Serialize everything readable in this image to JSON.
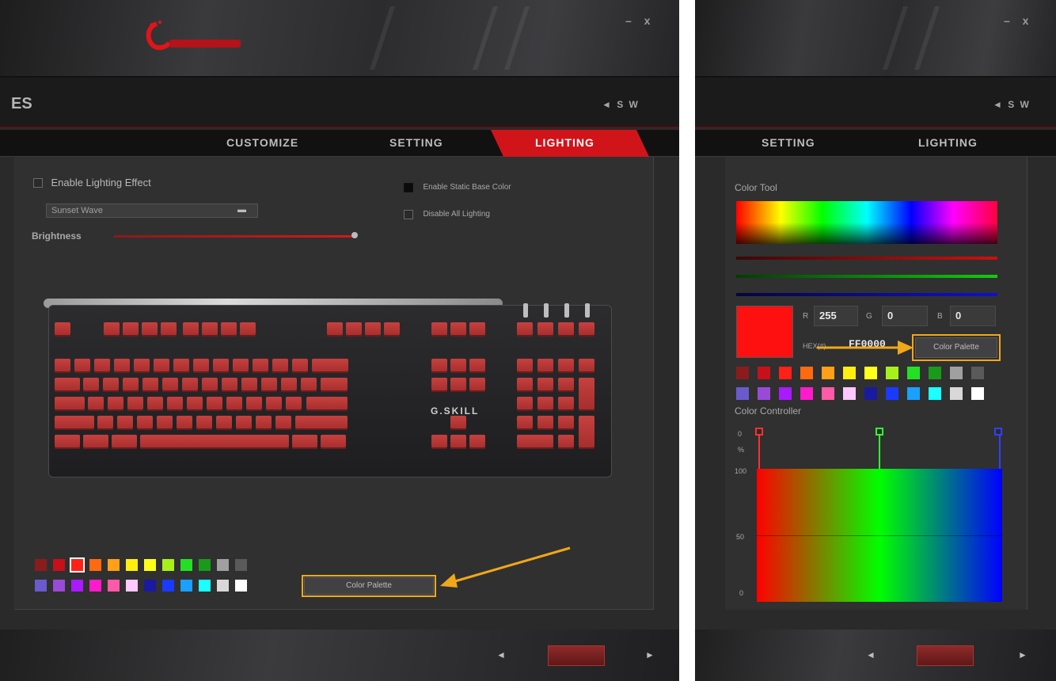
{
  "left": {
    "window_controls": "– x",
    "page_title": "ES",
    "profile_nav": "◄ S W",
    "tabs": [
      {
        "label": "CUSTOMIZE",
        "active": false
      },
      {
        "label": "SETTING",
        "active": false
      },
      {
        "label": "LIGHTING",
        "active": true
      }
    ],
    "enable_lighting_label": "Enable Lighting Effect",
    "effect_selected": "Sunset Wave",
    "brightness_label": "Brightness",
    "enable_static_label": "Enable Static Base Color",
    "disable_all_label": "Disable All Lighting",
    "keyboard_logo": "G.SKILL",
    "swatches_row1": [
      "#8a1c1c",
      "#c8101a",
      "#ff2018",
      "#ff6a10",
      "#ffa018",
      "#ffee10",
      "#ffff1a",
      "#a8f01a",
      "#24e024",
      "#1a9a1a",
      "#a0a0a0",
      "#5a5a5a"
    ],
    "swatches_row2": [
      "#6a5acd",
      "#9a4ad8",
      "#aa1aff",
      "#ff1acc",
      "#ff5aa8",
      "#ffc8ff",
      "#1a1aa0",
      "#1a3aff",
      "#1aa0ff",
      "#1affff",
      "#d8d8d8",
      "#ffffff"
    ],
    "selected_swatch_index": 2,
    "color_palette_button": "Color Palette"
  },
  "right": {
    "window_controls": "– x",
    "profile_nav": "◄ S W",
    "tabs": [
      {
        "label": "SETTING"
      },
      {
        "label": "LIGHTING"
      }
    ],
    "color_tool_label": "Color Tool",
    "r_label": "R",
    "g_label": "G",
    "b_label": "B",
    "r_value": "255",
    "g_value": "0",
    "b_value": "0",
    "hex_label": "HEX(#)",
    "hex_value": "FF0000",
    "preview_color": "#ff1010",
    "color_palette_button": "Color Palette",
    "swatches_row1": [
      "#8a1c1c",
      "#c8101a",
      "#ff2018",
      "#ff6a10",
      "#ffa018",
      "#ffee10",
      "#ffff1a",
      "#a8f01a",
      "#24e024",
      "#1a9a1a",
      "#a0a0a0",
      "#5a5a5a"
    ],
    "swatches_row2": [
      "#6a5acd",
      "#9a4ad8",
      "#aa1aff",
      "#ff1acc",
      "#ff5aa8",
      "#ffc8ff",
      "#1a1aa0",
      "#1a3aff",
      "#1aa0ff",
      "#1affff",
      "#d8d8d8",
      "#ffffff"
    ],
    "color_controller_label": "Color Controller",
    "cc_top_labels": [
      "0",
      "%"
    ],
    "cc_axis": [
      "100",
      "50",
      "0"
    ]
  },
  "colors": {
    "accent_red": "#d0141a",
    "highlight_orange": "#f0a818"
  }
}
